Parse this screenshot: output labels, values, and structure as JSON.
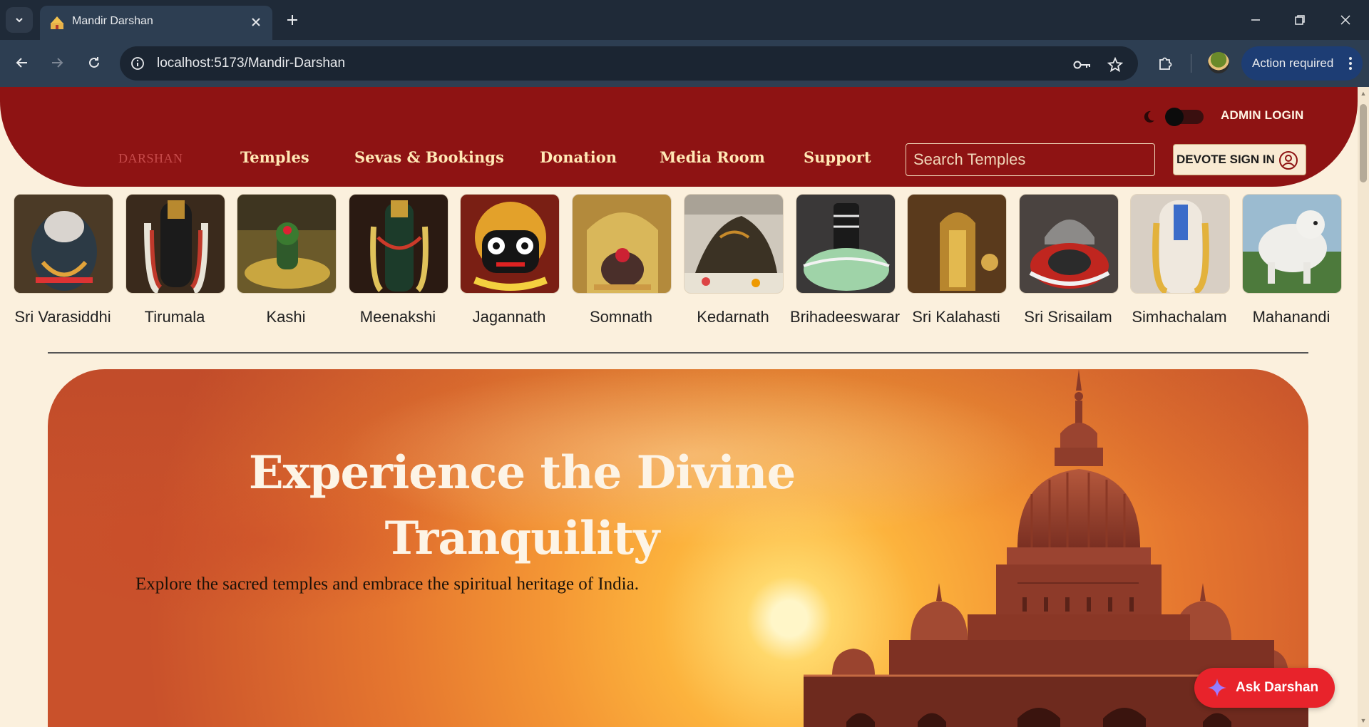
{
  "browser": {
    "tab_title": "Mandir Darshan",
    "url": "localhost:5173/Mandir-Darshan",
    "action_required_label": "Action required"
  },
  "header": {
    "admin_login": "ADMIN LOGIN",
    "logo_text": "DARSHAN",
    "nav": [
      "Temples",
      "Sevas & Bookings",
      "Donation",
      "Media Room",
      "Support"
    ],
    "search_placeholder": "Search Temples",
    "devote_sign_in": "DEVOTE SIGN IN"
  },
  "temples": [
    {
      "name": "Sri Varasiddhi"
    },
    {
      "name": "Tirumala"
    },
    {
      "name": "Kashi"
    },
    {
      "name": "Meenakshi"
    },
    {
      "name": "Jagannath"
    },
    {
      "name": "Somnath"
    },
    {
      "name": "Kedarnath"
    },
    {
      "name": "Brihadeeswarar"
    },
    {
      "name": "Sri Kalahasti"
    },
    {
      "name": "Sri Srisailam"
    },
    {
      "name": "Simhachalam"
    },
    {
      "name": "Mahanandi"
    }
  ],
  "hero": {
    "title_line1": "Experience the Divine",
    "title_line2": "Tranquility",
    "subtitle": "Explore the sacred temples and embrace the spiritual heritage of India."
  },
  "chatbot": {
    "label": "Ask Darshan"
  },
  "colors": {
    "header_red": "#8e1313",
    "page_cream": "#fbf0dd",
    "nav_gold": "#ffe8b5",
    "ask_red": "#e8232b"
  }
}
